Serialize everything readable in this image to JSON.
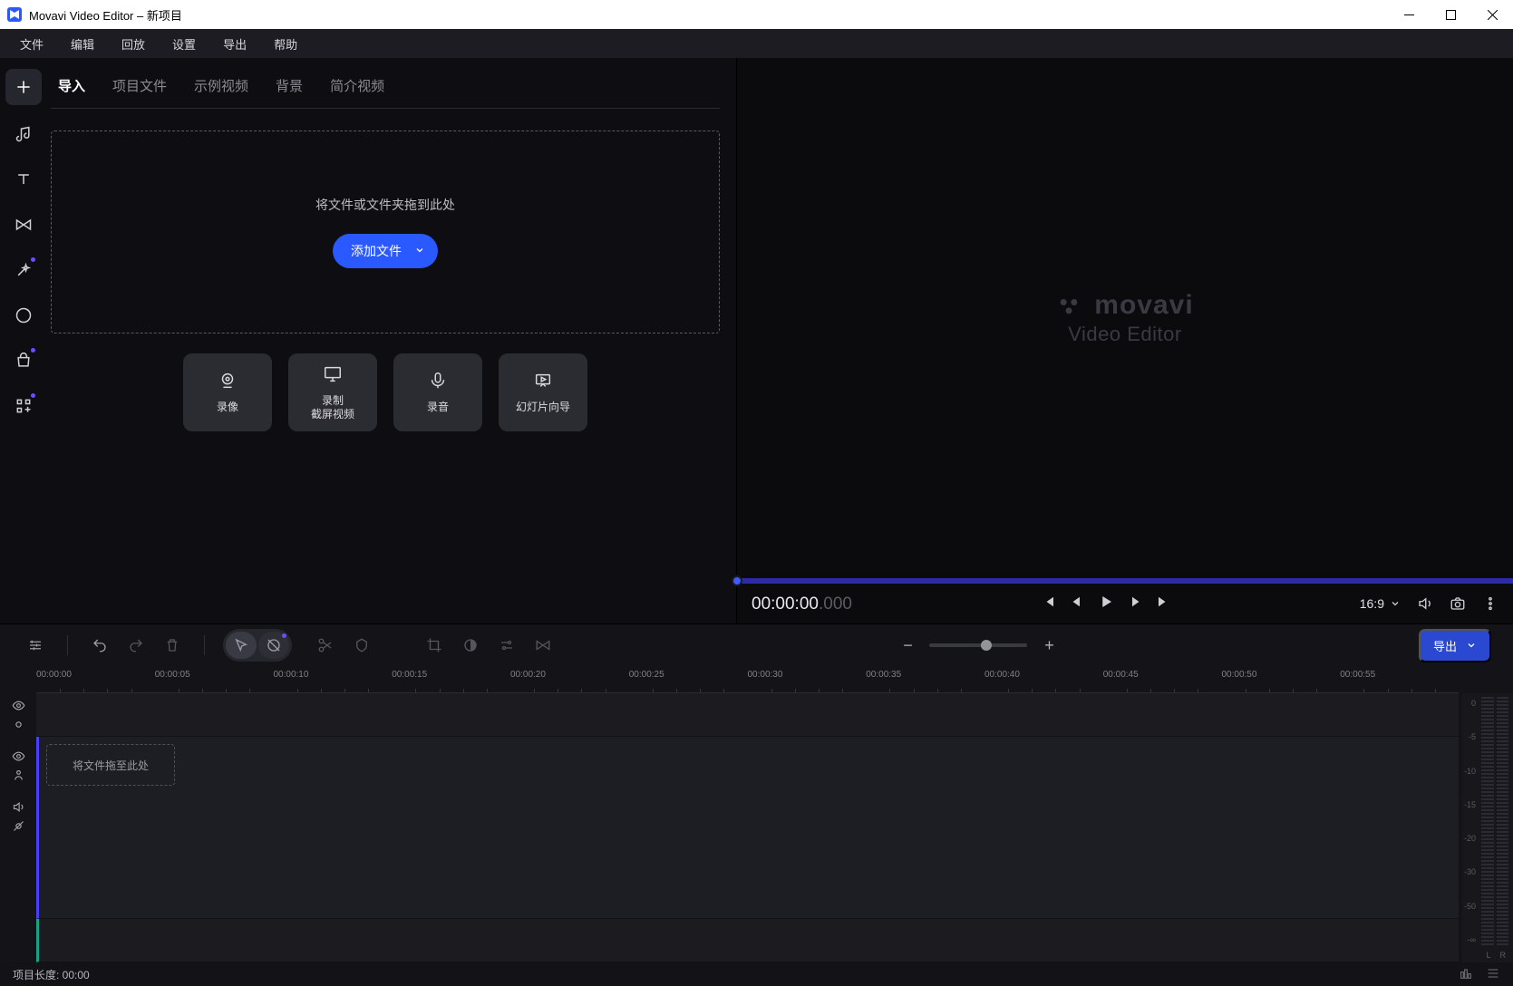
{
  "titlebar": {
    "title": "Movavi Video Editor – 新项目"
  },
  "menu": {
    "items": [
      "文件",
      "编辑",
      "回放",
      "设置",
      "导出",
      "帮助"
    ]
  },
  "sidebar_tools": [
    {
      "name": "add",
      "icon": "plus"
    },
    {
      "name": "audio",
      "icon": "music"
    },
    {
      "name": "text",
      "icon": "text"
    },
    {
      "name": "transitions",
      "icon": "bowtie"
    },
    {
      "name": "effects",
      "icon": "wand",
      "dot": true
    },
    {
      "name": "stickers",
      "icon": "sticker"
    },
    {
      "name": "elements",
      "icon": "bag",
      "dot": true
    },
    {
      "name": "more",
      "icon": "grid",
      "dot": true
    }
  ],
  "import": {
    "tabs": [
      {
        "label": "导入",
        "active": true
      },
      {
        "label": "项目文件"
      },
      {
        "label": "示例视频"
      },
      {
        "label": "背景"
      },
      {
        "label": "简介视频"
      }
    ],
    "dropzone_text": "将文件或文件夹拖到此处",
    "add_files_label": "添加文件",
    "cards": [
      {
        "label": "录像",
        "icon": "webcam"
      },
      {
        "label": "录制\n截屏视频",
        "icon": "screen"
      },
      {
        "label": "录音",
        "icon": "mic"
      },
      {
        "label": "幻灯片向导",
        "icon": "slideshow"
      }
    ]
  },
  "preview": {
    "brand": "movavi",
    "subtitle": "Video Editor",
    "timecode": "00:00:00",
    "timecode_ms": ".000",
    "aspect_ratio": "16:9"
  },
  "timeline": {
    "export_label": "导出",
    "ruler": [
      "00:00:00",
      "00:00:05",
      "00:00:10",
      "00:00:15",
      "00:00:20",
      "00:00:25",
      "00:00:30",
      "00:00:35",
      "00:00:40",
      "00:00:45",
      "00:00:50",
      "00:00:55"
    ],
    "lane_drop_text": "将文件拖至此处",
    "meter_marks": [
      "0",
      "-5",
      "-10",
      "-15",
      "-20",
      "-30",
      "-50",
      "-∞"
    ],
    "meter_lr": [
      "L",
      "R"
    ]
  },
  "status": {
    "project_length": "项目长度: 00:00"
  }
}
